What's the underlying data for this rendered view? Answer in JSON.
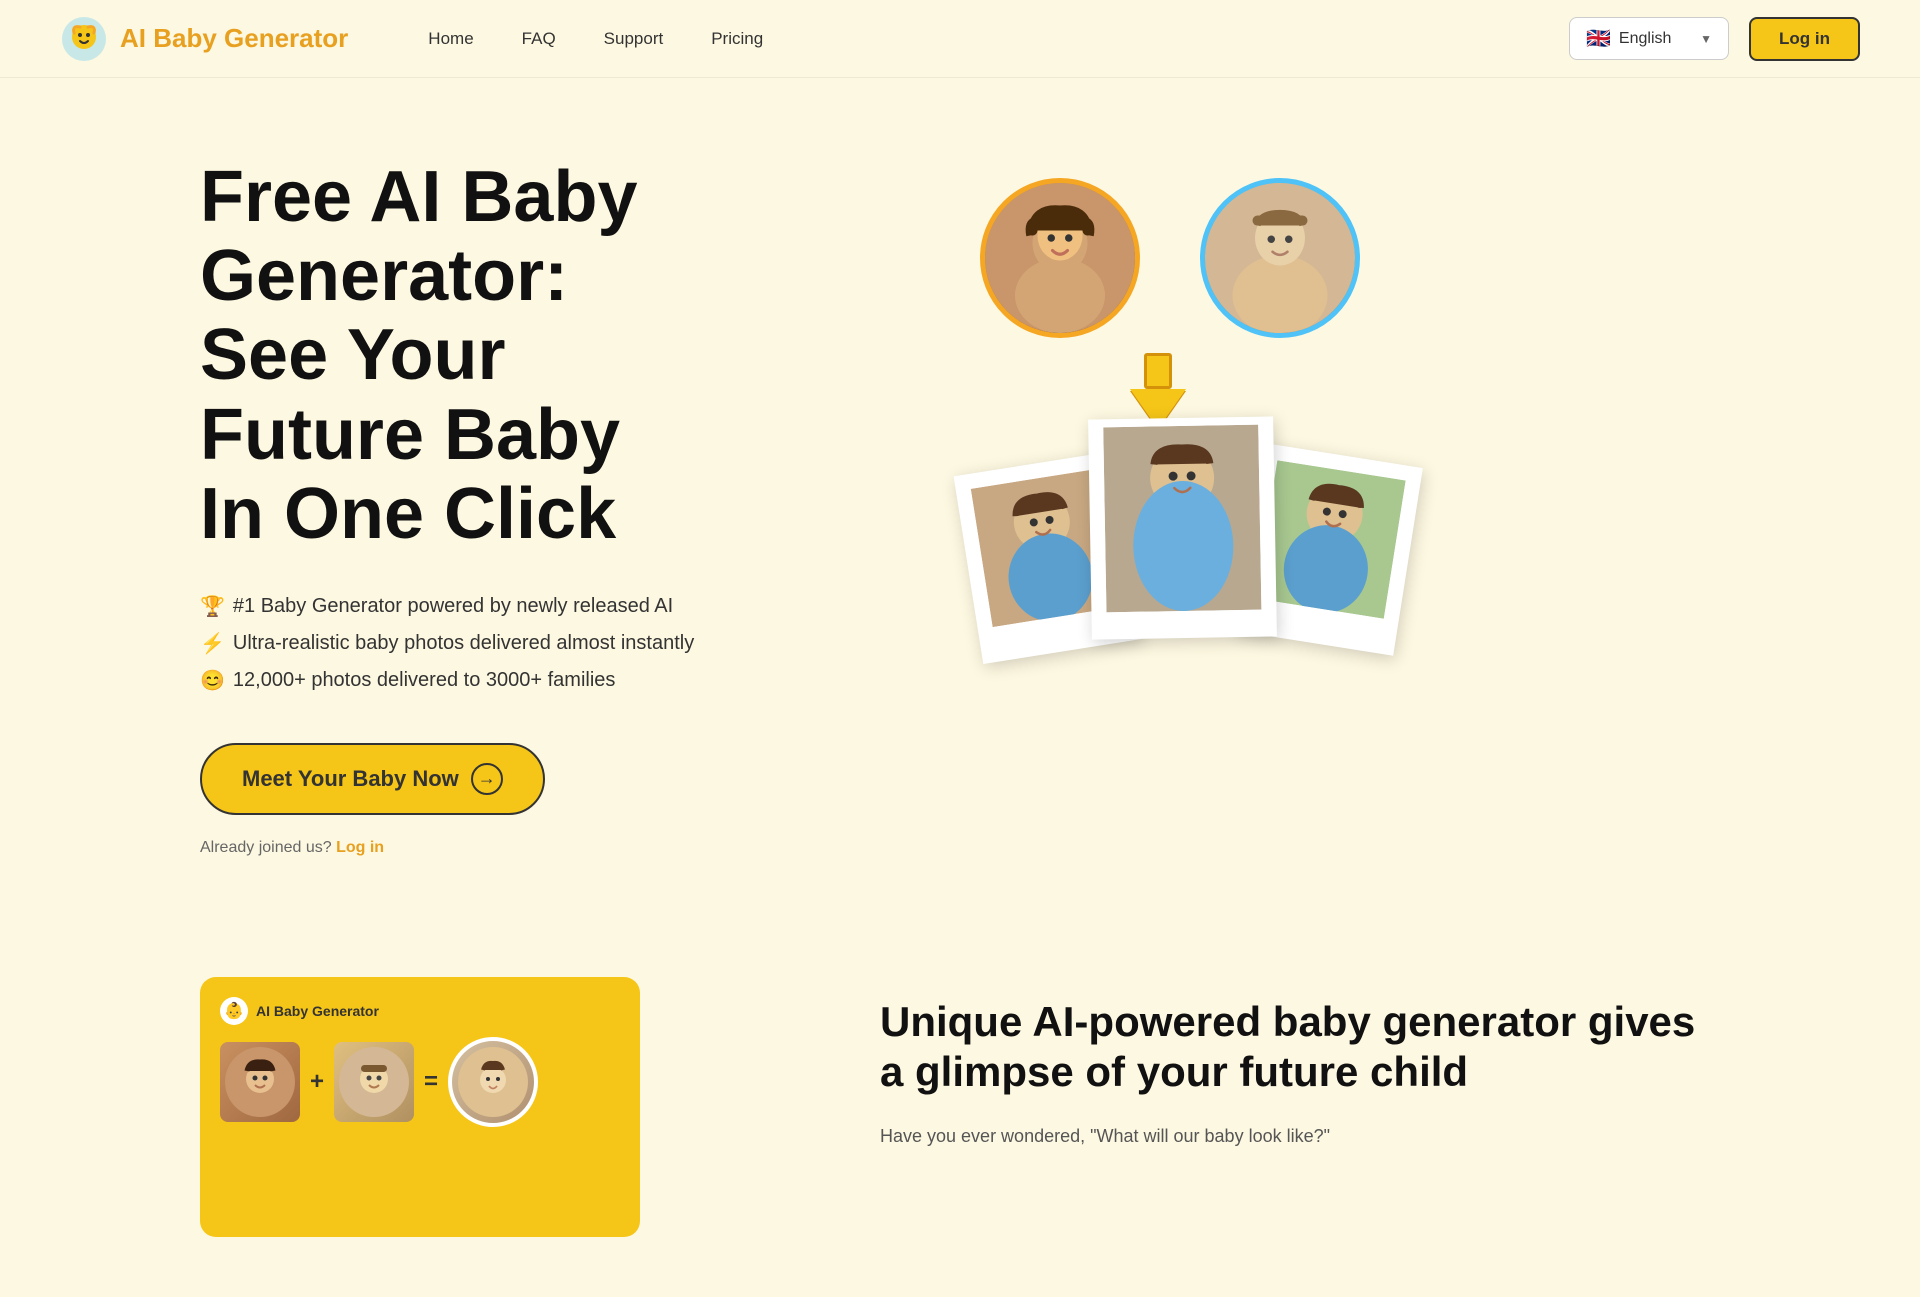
{
  "brand": {
    "name": "AI Baby Generator",
    "logo_emoji": "👶"
  },
  "nav": {
    "links": [
      {
        "label": "Home",
        "href": "#"
      },
      {
        "label": "FAQ",
        "href": "#"
      },
      {
        "label": "Support",
        "href": "#"
      },
      {
        "label": "Pricing",
        "href": "#"
      }
    ],
    "language": {
      "label": "English",
      "flag": "🇬🇧"
    },
    "login_label": "Log in"
  },
  "hero": {
    "title_line1": "Free AI Baby",
    "title_line2": "Generator:",
    "title_line3": "See Your",
    "title_line4": "Future Baby",
    "title_line5": "In One Click",
    "features": [
      {
        "icon": "🏆",
        "text": "#1 Baby Generator powered by newly released AI"
      },
      {
        "icon": "⚡",
        "text": "Ultra-realistic baby photos delivered almost instantly"
      },
      {
        "icon": "😊",
        "text": "12,000+ photos delivered to 3000+ families"
      }
    ],
    "cta_label": "Meet Your Baby Now",
    "already_joined": "Already joined us?",
    "login_link": "Log in"
  },
  "section2": {
    "title": "Unique AI-powered baby generator gives a glimpse of your future child",
    "description": "Have you ever wondered, \"What will our baby look like?\"",
    "app_name": "AI Baby Generator"
  },
  "illustration": {
    "mom_emoji": "👩",
    "dad_emoji": "👨",
    "baby_emojis": [
      "👧",
      "👧",
      "👧"
    ]
  }
}
